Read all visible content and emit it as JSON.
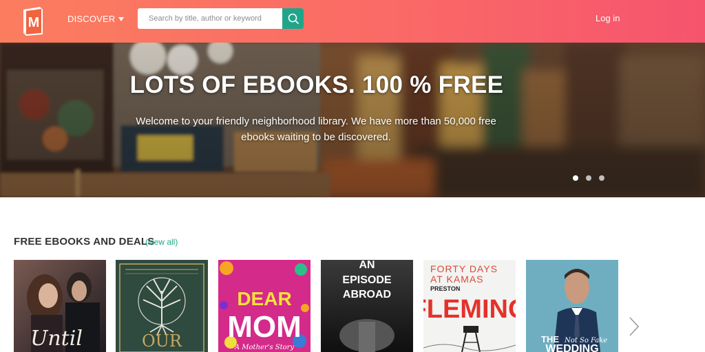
{
  "header": {
    "logo_letter": "M",
    "discover_label": "DISCOVER",
    "search_placeholder": "Search by title, author or keyword",
    "search_value": "",
    "login_label": "Log in"
  },
  "hero": {
    "title": "LOTS OF EBOOKS. 100 % FREE",
    "subtitle": "Welcome to your friendly neighborhood library. We have more than 50,000 free ebooks waiting to be discovered.",
    "slides_count": 3,
    "active_slide": 1
  },
  "deals": {
    "title": "FREE EBOOKS AND DEALS",
    "view_all": "(view all)",
    "books": [
      {
        "cover_text": "Until"
      },
      {
        "cover_text": "OUR"
      },
      {
        "cover_text_1": "DEAR",
        "cover_text_2": "MOM",
        "cover_text_3": "A Mother's Story"
      },
      {
        "cover_text_1": "AN",
        "cover_text_2": "EPISODE",
        "cover_text_3": "ABROAD"
      },
      {
        "cover_text_1": "FORTY DAYS",
        "cover_text_2": "AT KAMAS",
        "cover_text_3": "PRESTON",
        "cover_text_4": "FLEMING"
      },
      {
        "cover_text_1": "THE",
        "cover_text_2": "Not So Fake",
        "cover_text_3": "WEDDING"
      }
    ]
  },
  "colors": {
    "header_start": "#fb7d5f",
    "header_end": "#f6546e",
    "accent_green": "#20a58a"
  },
  "icons": [
    "book-logo-icon",
    "chevron-down-icon",
    "search-icon",
    "chevron-right-icon"
  ]
}
